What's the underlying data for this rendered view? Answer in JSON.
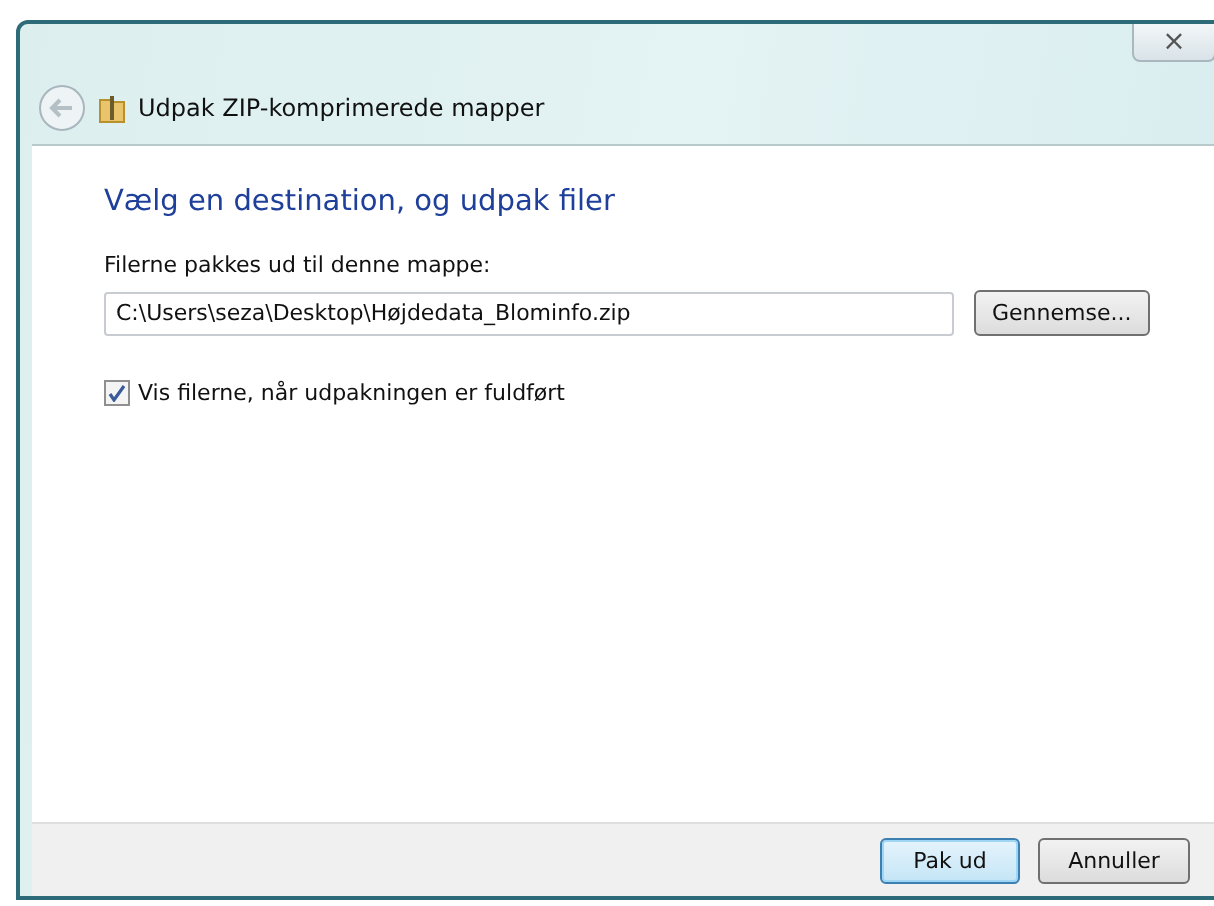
{
  "window": {
    "title": "Udpak ZIP-komprimerede mapper",
    "close": "×"
  },
  "heading": "Vælg en destination, og udpak filer",
  "destination": {
    "label": "Filerne pakkes ud til denne mappe:",
    "value": "C:\\Users\\seza\\Desktop\\Højdedata_Blominfo.zip",
    "browse": "Gennemse..."
  },
  "show_files": {
    "label": "Vis filerne, når udpakningen er fuldført",
    "checked": true
  },
  "buttons": [
    {
      "label": "Pak ud",
      "default": true
    },
    {
      "label": "Annuller",
      "default": false
    }
  ]
}
